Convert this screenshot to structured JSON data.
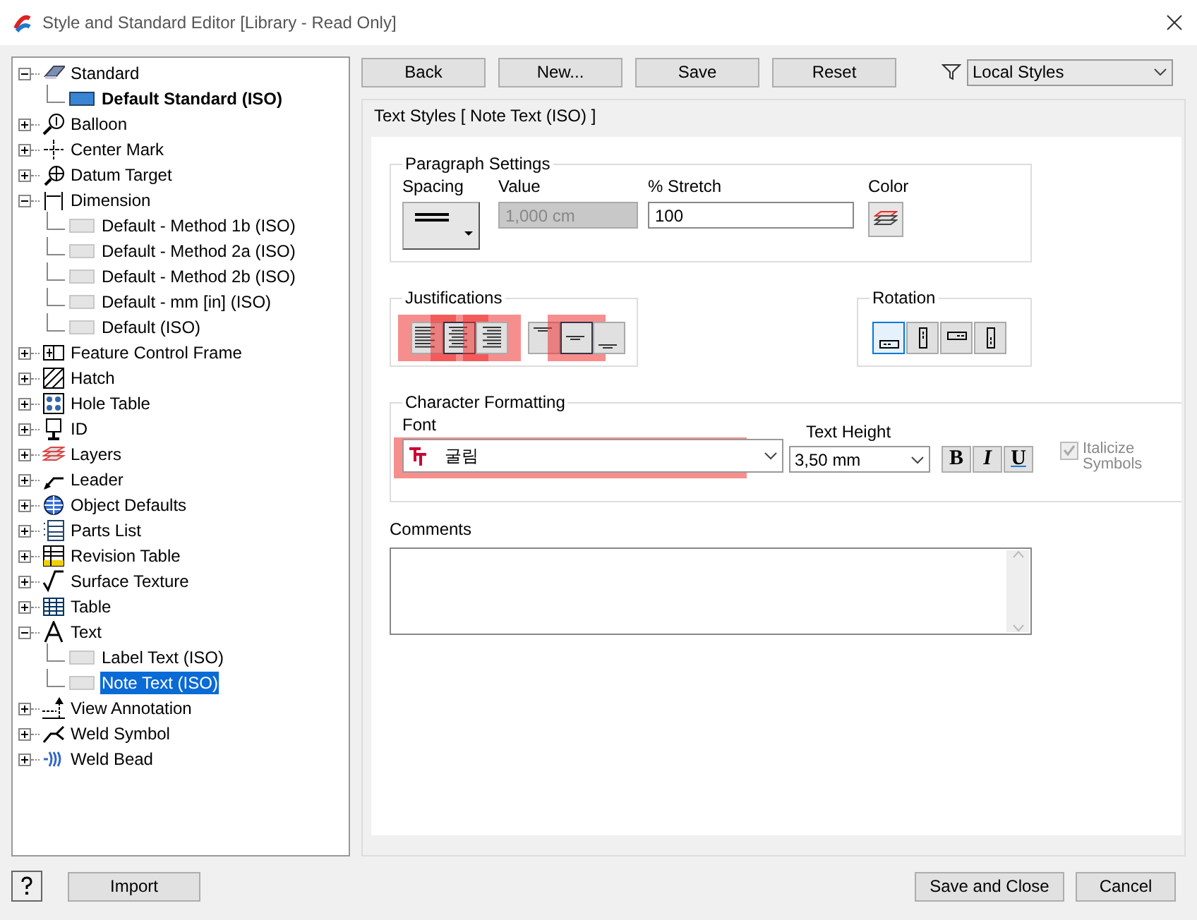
{
  "window": {
    "title": "Style and Standard Editor [Library - Read Only]"
  },
  "tree": [
    {
      "label": "Standard",
      "expanded": true,
      "children": [
        {
          "label": "Default Standard (ISO)",
          "in_use": true,
          "selected": false
        }
      ]
    },
    {
      "label": "Balloon",
      "expanded": false
    },
    {
      "label": "Center Mark",
      "expanded": false
    },
    {
      "label": "Datum Target",
      "expanded": false
    },
    {
      "label": "Dimension",
      "expanded": true,
      "children": [
        {
          "label": "Default - Method 1b (ISO)",
          "in_use": false,
          "selected": false
        },
        {
          "label": "Default - Method 2a (ISO)",
          "in_use": false,
          "selected": false
        },
        {
          "label": "Default - Method 2b (ISO)",
          "in_use": false,
          "selected": false
        },
        {
          "label": "Default - mm [in] (ISO)",
          "in_use": false,
          "selected": false
        },
        {
          "label": "Default (ISO)",
          "in_use": false,
          "selected": false
        }
      ]
    },
    {
      "label": "Feature Control Frame",
      "expanded": false
    },
    {
      "label": "Hatch",
      "expanded": false
    },
    {
      "label": "Hole Table",
      "expanded": false
    },
    {
      "label": "ID",
      "expanded": false
    },
    {
      "label": "Layers",
      "expanded": false
    },
    {
      "label": "Leader",
      "expanded": false
    },
    {
      "label": "Object Defaults",
      "expanded": false
    },
    {
      "label": "Parts List",
      "expanded": false
    },
    {
      "label": "Revision Table",
      "expanded": false
    },
    {
      "label": "Surface Texture",
      "expanded": false
    },
    {
      "label": "Table",
      "expanded": false
    },
    {
      "label": "Text",
      "expanded": true,
      "children": [
        {
          "label": "Label Text (ISO)",
          "in_use": false,
          "selected": false
        },
        {
          "label": "Note Text (ISO)",
          "in_use": false,
          "selected": true
        }
      ]
    },
    {
      "label": "View Annotation",
      "expanded": false
    },
    {
      "label": "Weld Symbol",
      "expanded": false
    },
    {
      "label": "Weld Bead",
      "expanded": false
    }
  ],
  "toolbar": {
    "buttons": [
      "Back",
      "New...",
      "Save",
      "Reset"
    ],
    "filter": "Local Styles"
  },
  "panel_title": "Text Styles [ Note Text (ISO) ]",
  "paragraph": {
    "title": "Paragraph Settings",
    "spacing_label": "Spacing",
    "value_label": "Value",
    "value": "1,000 cm",
    "value_disabled": true,
    "stretch_label": "% Stretch",
    "stretch": "100",
    "color_label": "Color"
  },
  "justifications": {
    "title": "Justifications",
    "horizontal": [
      {
        "selected": false,
        "highlighted": true
      },
      {
        "selected": true,
        "highlighted": true
      },
      {
        "selected": false,
        "highlighted": true
      }
    ],
    "vertical": [
      {
        "selected": false,
        "highlighted": false
      },
      {
        "selected": true,
        "highlighted": true
      },
      {
        "selected": false,
        "highlighted": false
      }
    ]
  },
  "rotation": {
    "title": "Rotation",
    "options": [
      {
        "selected": true
      },
      {
        "selected": false
      },
      {
        "selected": false
      },
      {
        "selected": false
      }
    ]
  },
  "character": {
    "title": "Character Formatting",
    "font_label": "Font",
    "font": "굴림",
    "font_highlighted": true,
    "height_label": "Text Height",
    "height": "3,50 mm",
    "bold": "B",
    "italic": "I",
    "underline": "U",
    "italicize_symbols": {
      "label": "Italicize Symbols",
      "checked": true,
      "disabled": true
    }
  },
  "comments": {
    "label": "Comments"
  },
  "footer": {
    "import": "Import",
    "save_close": "Save and Close",
    "cancel": "Cancel"
  }
}
